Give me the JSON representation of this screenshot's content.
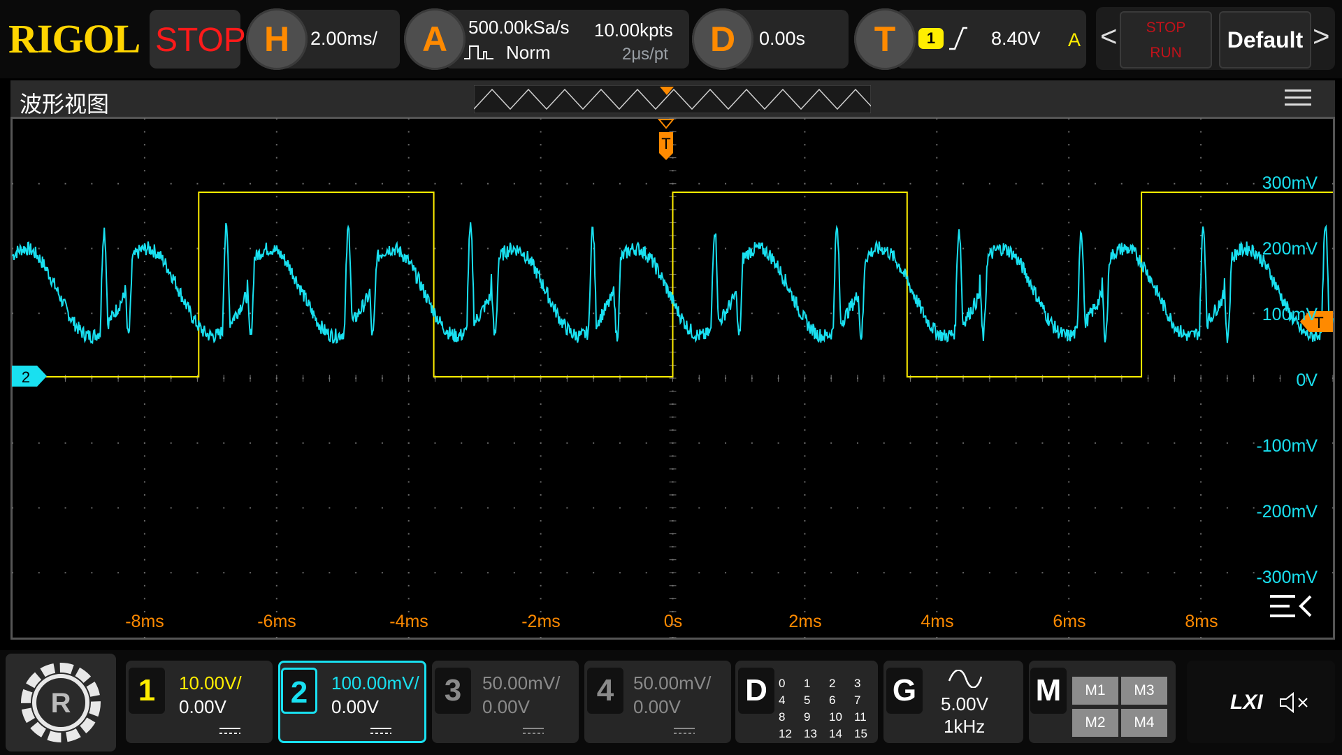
{
  "brand": "RIGOL",
  "run_state": "STOP",
  "horizontal": {
    "letter": "H",
    "timebase": "2.00ms/"
  },
  "acquire": {
    "letter": "A",
    "sample_rate": "500.00kSa/s",
    "memory_depth": "10.00kpts",
    "mode": "Norm",
    "resolution": "2μs/pt"
  },
  "delay": {
    "letter": "D",
    "value": "0.00s"
  },
  "trigger": {
    "letter": "T",
    "source": "1",
    "level": "8.40V",
    "sweep": "A"
  },
  "buttons": {
    "stop_line1": "STOP",
    "stop_line2": "RUN",
    "default": "Default",
    "prev": "<",
    "next": ">"
  },
  "wave_view": {
    "title": "波形视图",
    "trigger_marker": "T",
    "ch2_marker": "2"
  },
  "x_axis_labels": [
    "-8ms",
    "-6ms",
    "-4ms",
    "-2ms",
    "0s",
    "2ms",
    "4ms",
    "6ms",
    "8ms"
  ],
  "y_axis_labels": [
    "300mV",
    "200mV",
    "100mV",
    "0V",
    "-100mV",
    "-200mV",
    "-300mV"
  ],
  "channels": [
    {
      "num": "1",
      "scale": "10.00V/",
      "offset": "0.00V",
      "active": true,
      "color": "#ffee00"
    },
    {
      "num": "2",
      "scale": "100.00mV/",
      "offset": "0.00V",
      "active": true,
      "selected": true,
      "color": "#19e0f0"
    },
    {
      "num": "3",
      "scale": "50.00mV/",
      "offset": "0.00V",
      "active": false,
      "color": "#8a8a8a"
    },
    {
      "num": "4",
      "scale": "50.00mV/",
      "offset": "0.00V",
      "active": false,
      "color": "#8a8a8a"
    }
  ],
  "digital": {
    "letter": "D",
    "channels": [
      "0",
      "1",
      "2",
      "3",
      "4",
      "5",
      "6",
      "7",
      "8",
      "9",
      "10",
      "11",
      "12",
      "13",
      "14",
      "15"
    ]
  },
  "generator": {
    "letter": "G",
    "amplitude": "5.00V",
    "frequency": "1kHz"
  },
  "math": {
    "letter": "M",
    "items": [
      "M1",
      "M3",
      "M2",
      "M4"
    ]
  },
  "lxi": "LXI",
  "colors": {
    "ch1": "#ffee00",
    "ch2": "#19e0f0",
    "trigger": "#ff8a00",
    "stop": "#ff1a1a",
    "brand": "#ffd400"
  },
  "icons": {
    "menu": "hamburger-icon",
    "gear": "gear-icon",
    "speaker": "speaker-muted-icon",
    "collapse": "collapse-menu-icon",
    "sine": "sine-wave-icon"
  }
}
